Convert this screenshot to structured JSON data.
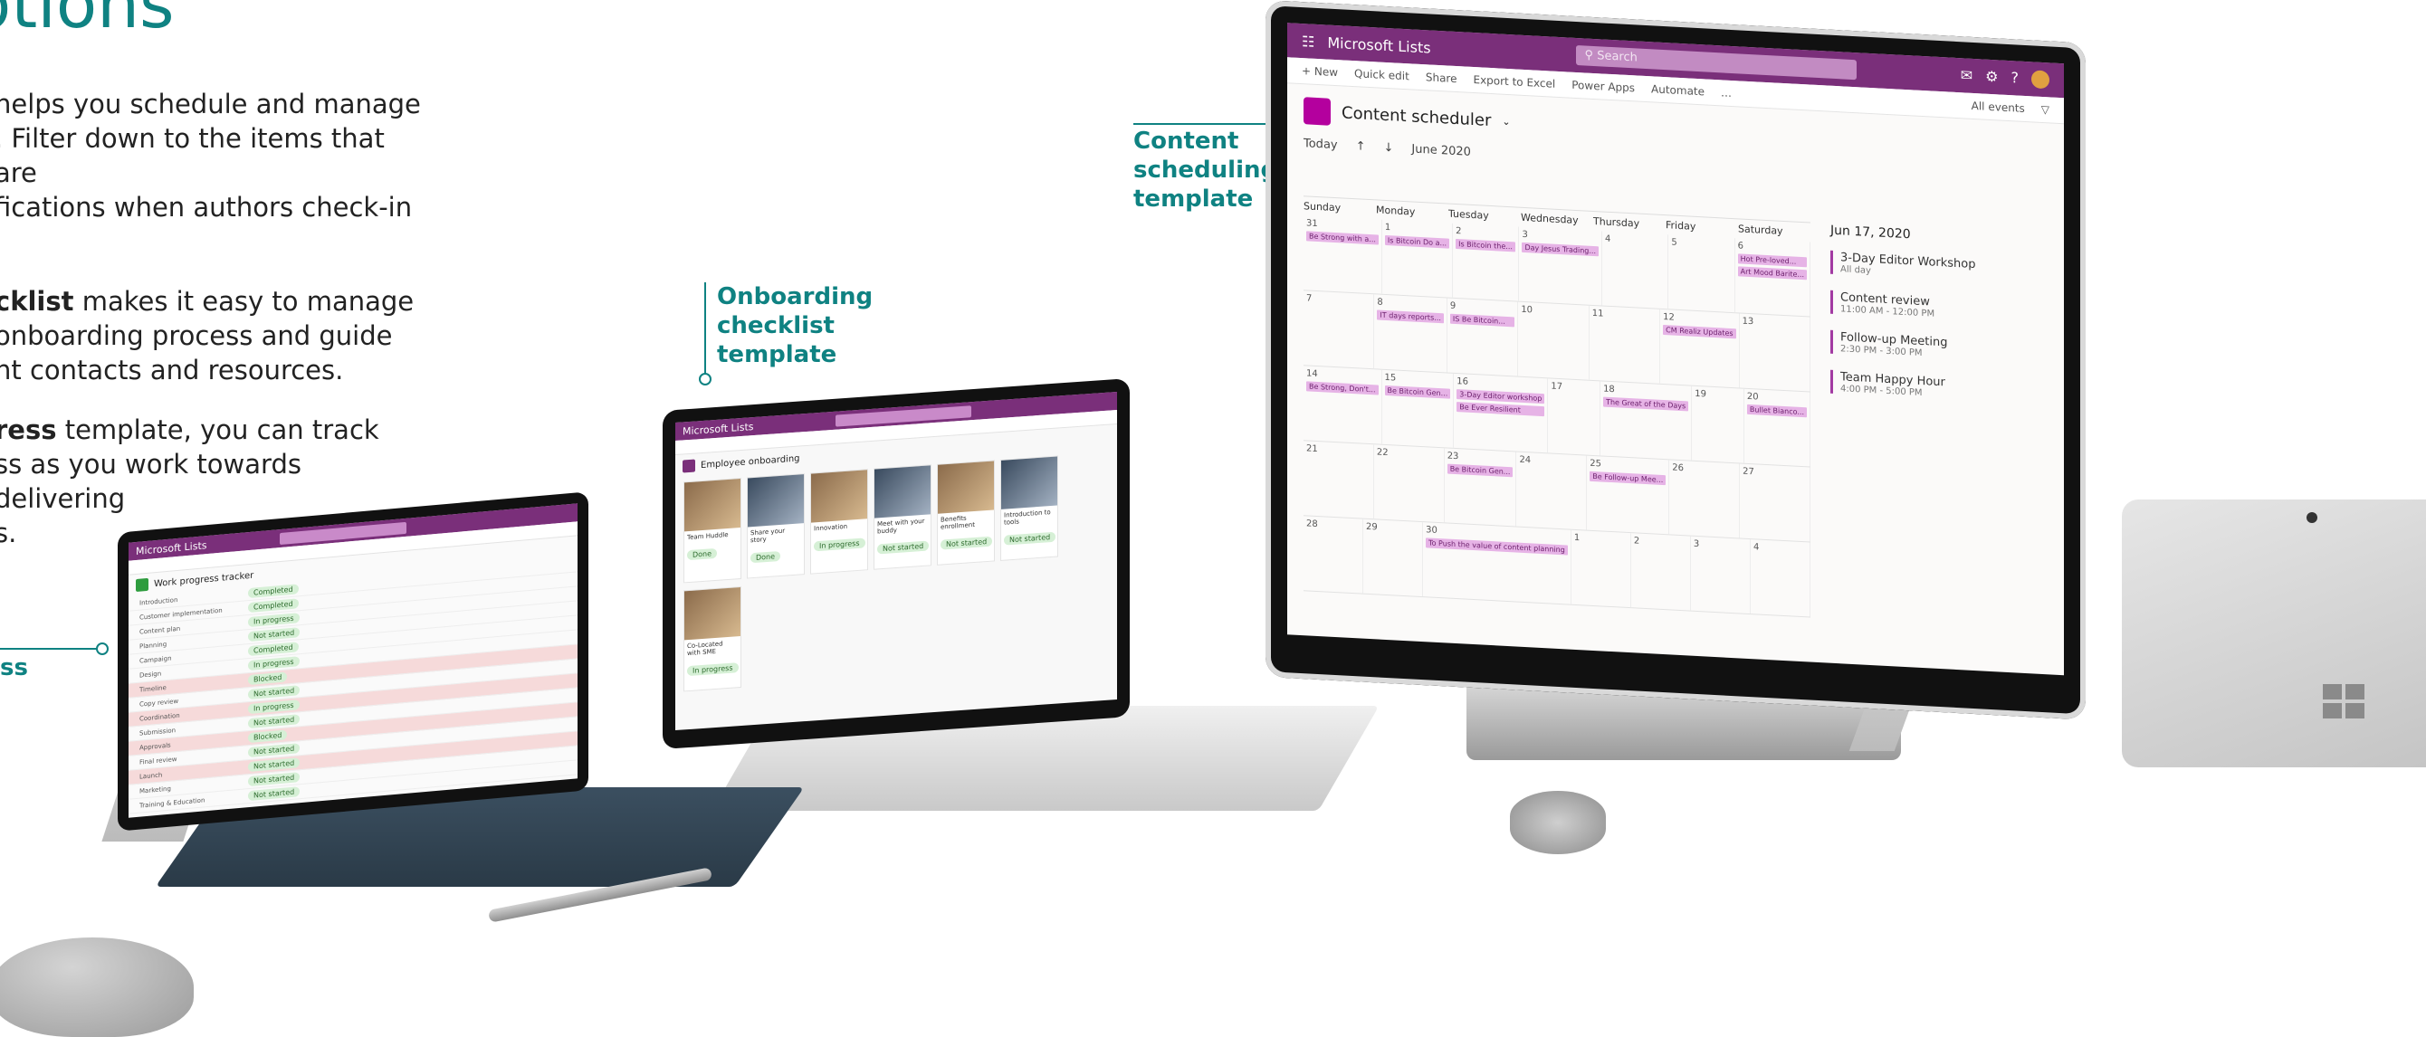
{
  "heading": "options",
  "paragraphs": {
    "p1": "helps you schedule and manage\n. Filter down to the items that are\nfications when authors check-in",
    "p2_bold": "cklist",
    "p2_rest": " makes it easy to manage\n onboarding process and guide\nnt contacts and resources.",
    "p3_bold": "ress",
    "p3_rest": " template, you can track\nss as you work towards delivering\ns."
  },
  "callouts": {
    "content": "Content\nscheduling\ntemplate",
    "onboarding": "Onboarding\nchecklist\ntemplate",
    "progress": "ss"
  },
  "calendar_app": {
    "brand": "Microsoft Lists",
    "search_placeholder": "Search",
    "commands": [
      "+ New",
      "Quick edit",
      "Share",
      "Export to Excel",
      "Power Apps",
      "Automate",
      "…"
    ],
    "view": "All events",
    "list_title": "Content scheduler",
    "today": "Today",
    "month": "June 2020",
    "weekdays": [
      "Sunday",
      "Monday",
      "Tuesday",
      "Wednesday",
      "Thursday",
      "Friday",
      "Saturday"
    ],
    "agenda_date": "Jun 17, 2020",
    "agenda": [
      {
        "title": "3-Day Editor Workshop",
        "time": "All day"
      },
      {
        "title": "Content review",
        "time": "11:00 AM - 12:00 PM"
      },
      {
        "title": "Follow-up Meeting",
        "time": "2:30 PM - 3:00 PM"
      },
      {
        "title": "Team Happy Hour",
        "time": "4:00 PM - 5:00 PM"
      }
    ],
    "weeks": [
      {
        "dates": [
          "31",
          "1",
          "2",
          "3",
          "4",
          "5",
          "6"
        ],
        "events": [
          [
            "Be Strong with a...",
            "",
            "Is Bitcoin the...",
            "Day Jesus Trading...",
            "",
            "",
            "Hot Pre-loved..."
          ],
          [
            "",
            "Is Bitcoin Do a...",
            "",
            "",
            "",
            "",
            "Art Mood Barite..."
          ]
        ]
      },
      {
        "dates": [
          "7",
          "8",
          "9",
          "10",
          "11",
          "12",
          "13"
        ],
        "events": [
          [
            "",
            "IT days reports...",
            "",
            "",
            "",
            "CM Realiz Updates",
            ""
          ],
          [
            "",
            "",
            "IS Be Bitcoin...",
            "",
            "",
            "",
            ""
          ]
        ]
      },
      {
        "dates": [
          "14",
          "15",
          "16",
          "17",
          "18",
          "19",
          "20"
        ],
        "events": [
          [
            "Be Strong, Don't...",
            "Be Bitcoin Gen...",
            "3-Day Editor workshop",
            "",
            "The Great of the Days",
            "",
            "Bullet Bianco..."
          ],
          [
            "",
            "",
            "Be Ever Resilient",
            "",
            "",
            "",
            ""
          ]
        ]
      },
      {
        "dates": [
          "21",
          "22",
          "23",
          "24",
          "25",
          "26",
          "27"
        ],
        "events": [
          [
            "",
            "",
            "Be Bitcoin Gen...",
            "",
            "Be Follow-up Mee...",
            "",
            ""
          ]
        ]
      },
      {
        "dates": [
          "28",
          "29",
          "30",
          "1",
          "2",
          "3",
          "4"
        ],
        "events": [
          [
            "",
            "",
            "To Push the value of content planning",
            "",
            "",
            "",
            ""
          ]
        ]
      }
    ]
  },
  "onboarding_app": {
    "brand": "Microsoft Lists",
    "list_title": "Employee onboarding",
    "cards": [
      {
        "title": "Team Huddle",
        "status": "Done"
      },
      {
        "title": "Share your story",
        "status": "Done"
      },
      {
        "title": "Innovation",
        "status": "In progress"
      },
      {
        "title": "Meet with your buddy",
        "status": "Not started"
      },
      {
        "title": "Benefits enrollment",
        "status": "Not started"
      },
      {
        "title": "Introduction to tools",
        "status": "Not started"
      },
      {
        "title": "Co-Located with SME",
        "status": "In progress"
      }
    ]
  },
  "progress_app": {
    "brand": "Microsoft Lists",
    "list_title": "Work progress tracker",
    "rows": [
      {
        "item": "Introduction",
        "status": "Completed",
        "highlight": false
      },
      {
        "item": "Customer implementation",
        "status": "Completed",
        "highlight": false
      },
      {
        "item": "Content plan",
        "status": "In progress",
        "highlight": false
      },
      {
        "item": "Planning",
        "status": "Not started",
        "highlight": false
      },
      {
        "item": "Campaign",
        "status": "Completed",
        "highlight": false
      },
      {
        "item": "Design",
        "status": "In progress",
        "highlight": false
      },
      {
        "item": "Timeline",
        "status": "Blocked",
        "highlight": true
      },
      {
        "item": "Copy review",
        "status": "Not started",
        "highlight": false
      },
      {
        "item": "Coordination",
        "status": "In progress",
        "highlight": true
      },
      {
        "item": "Submission",
        "status": "Not started",
        "highlight": false
      },
      {
        "item": "Approvals",
        "status": "Blocked",
        "highlight": true
      },
      {
        "item": "Final review",
        "status": "Not started",
        "highlight": false
      },
      {
        "item": "Launch",
        "status": "Not started",
        "highlight": true
      },
      {
        "item": "Marketing",
        "status": "Not started",
        "highlight": false
      },
      {
        "item": "Training & Education",
        "status": "Not started",
        "highlight": false
      }
    ]
  },
  "colors": {
    "teal": "#0f8282",
    "suite_purple": "#7a2f7a",
    "event_pink": "#e6b3e6"
  }
}
